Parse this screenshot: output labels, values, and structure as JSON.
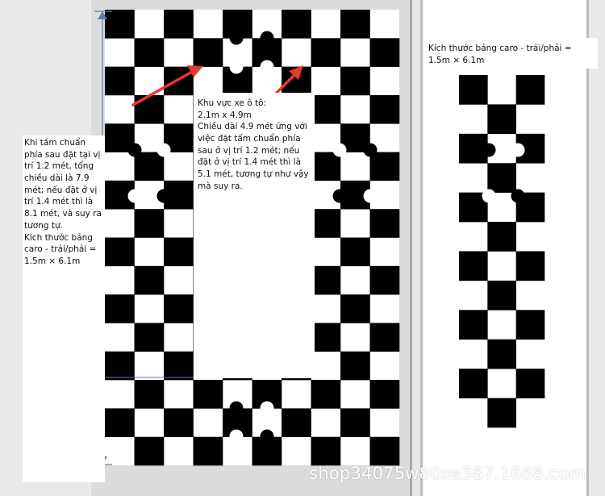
{
  "labels": {
    "left_note": "Khi tấm chuẩn phía sau đặt tại vị trí 1.2 mét, tổng chiều dài là 7.9 mét; nếu đặt ở vị trí 1.4 mét thì là 8.1 mét, và suy ra tương tự.\nKích thước bảng caro - trái/phải = 1.5m × 6.1m",
    "center_note": "Khu vực xe ô tô:\n 2.1m x 4.9m\n Chiều dài 4.9 mét ứng với việc đặt tấm chuẩn phía sau ở vị trí 1.2 mét; nếu đặt ở vị trí 1.4 mét thì là 5.1 mét, tương tự như vậy mà suy ra.",
    "right_note": "Kích thước bảng caro - trái/phải = 1.5m × 6.1m"
  },
  "watermark": "shop34075w80xe387.1688.com",
  "colors": {
    "background": "#e9e9e9",
    "panel": "#ffffff",
    "checker_dark": "#000000",
    "checker_light": "#ffffff",
    "arrow": "#e8392b",
    "dimension_line": "#5a7fa8",
    "marker_fill_dark": "#000000",
    "marker_fill_light": "#ffffff"
  }
}
